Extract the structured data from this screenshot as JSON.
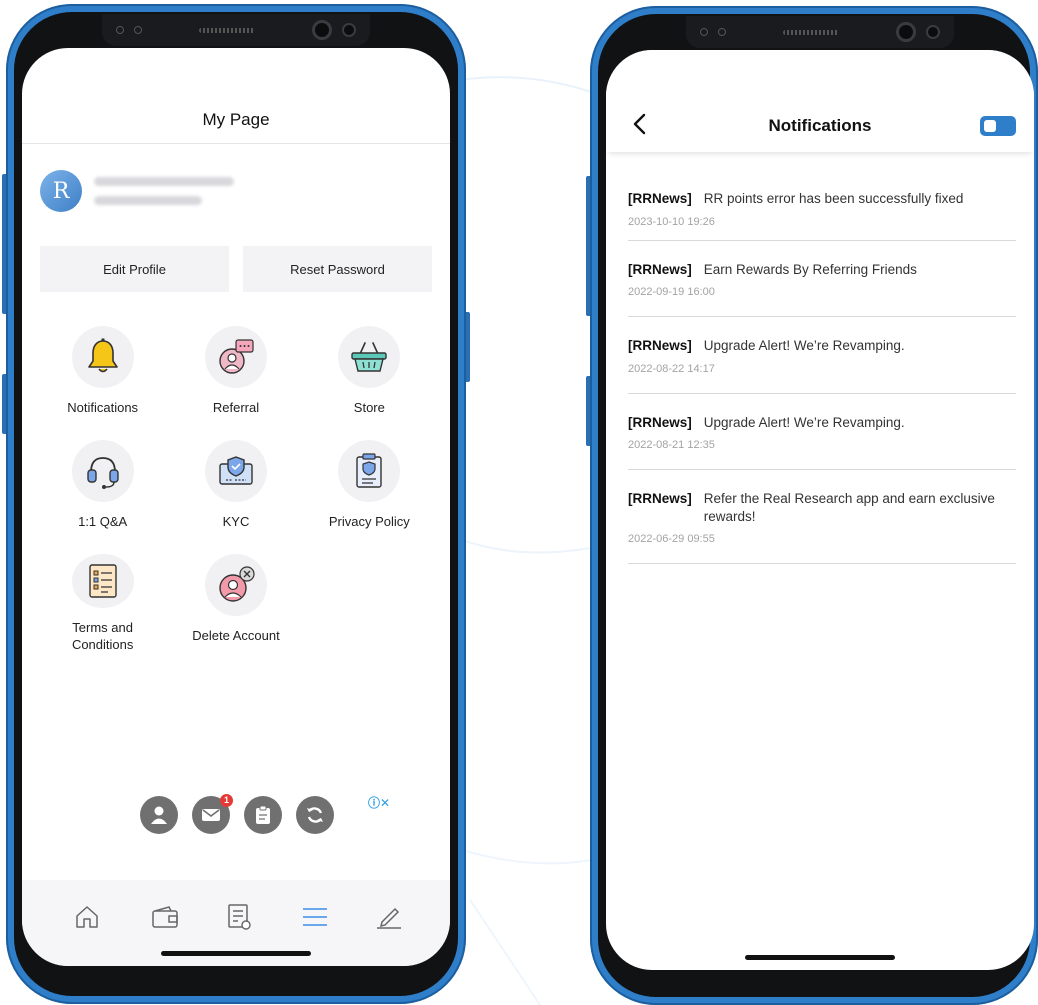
{
  "my_page": {
    "title": "My Page",
    "edit_profile": "Edit Profile",
    "reset_password": "Reset Password",
    "menu": [
      {
        "label": "Notifications",
        "icon": "bell-icon"
      },
      {
        "label": "Referral",
        "icon": "referral-icon"
      },
      {
        "label": "Store",
        "icon": "basket-icon"
      },
      {
        "label": "1:1 Q&A",
        "icon": "headset-icon"
      },
      {
        "label": "KYC",
        "icon": "id-card-icon"
      },
      {
        "label": "Privacy Policy",
        "icon": "document-shield-icon"
      },
      {
        "label": "Terms and Conditions",
        "icon": "checklist-icon"
      },
      {
        "label": "Delete Account",
        "icon": "delete-user-icon"
      }
    ],
    "ad_badge": "1",
    "tabs": [
      "home-icon",
      "wallet-icon",
      "survey-icon",
      "menu-icon",
      "edit-icon"
    ],
    "active_tab_color": "#3a8ee6"
  },
  "notifications": {
    "title": "Notifications",
    "items": [
      {
        "tag": "[RRNews]",
        "message": "RR points error has been successfully fixed",
        "date": "2023-10-10 19:26"
      },
      {
        "tag": "[RRNews]",
        "message": "Earn Rewards By Referring Friends",
        "date": "2022-09-19 16:00"
      },
      {
        "tag": "[RRNews]",
        "message": "Upgrade Alert! We’re Revamping.",
        "date": "2022-08-22 14:17"
      },
      {
        "tag": "[RRNews]",
        "message": "Upgrade Alert! We’re Revamping.",
        "date": "2022-08-21 12:35"
      },
      {
        "tag": "[RRNews]",
        "message": "Refer the Real Research app and earn exclusive rewards!",
        "date": "2022-06-29 09:55"
      }
    ]
  },
  "colors": {
    "frame": "#2f7ec9",
    "accent": "#3a8ee6",
    "bell": "#f5c518"
  }
}
